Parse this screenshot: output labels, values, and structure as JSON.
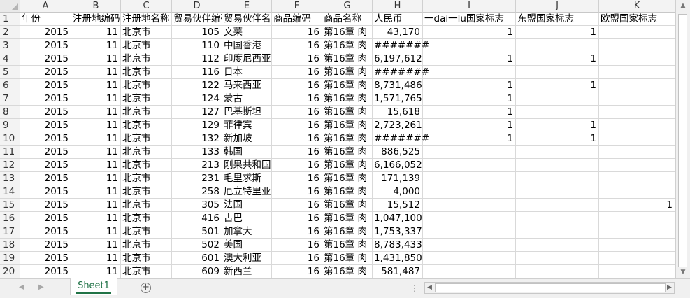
{
  "columns": [
    "A",
    "B",
    "C",
    "D",
    "E",
    "F",
    "G",
    "H",
    "I",
    "J",
    "K"
  ],
  "header_row": [
    "年份",
    "注册地编码",
    "注册地名称",
    "贸易伙伴编码",
    "贸易伙伴名称",
    "商品编码",
    "商品名称",
    "人民币",
    "一dai一lu国家标志",
    "东盟国家标志",
    "欧盟国家标志"
  ],
  "row_numbers": [
    "1",
    "2",
    "3",
    "4",
    "5",
    "6",
    "7",
    "8",
    "9",
    "10",
    "11",
    "12",
    "13",
    "14",
    "15",
    "16",
    "17",
    "18",
    "19",
    "20"
  ],
  "rows": [
    [
      "2015",
      "11",
      "北京市",
      "105",
      "文莱",
      "16",
      "第16章 肉",
      "43,170",
      "1",
      "1",
      ""
    ],
    [
      "2015",
      "11",
      "北京市",
      "110",
      "中国香港",
      "16",
      "第16章 肉",
      "#######",
      "",
      "",
      ""
    ],
    [
      "2015",
      "11",
      "北京市",
      "112",
      "印度尼西亚",
      "16",
      "第16章 肉",
      "6,197,612",
      "1",
      "1",
      ""
    ],
    [
      "2015",
      "11",
      "北京市",
      "116",
      "日本",
      "16",
      "第16章 肉",
      "#######",
      "",
      "",
      ""
    ],
    [
      "2015",
      "11",
      "北京市",
      "122",
      "马来西亚",
      "16",
      "第16章 肉",
      "8,731,486",
      "1",
      "1",
      ""
    ],
    [
      "2015",
      "11",
      "北京市",
      "124",
      "蒙古",
      "16",
      "第16章 肉",
      "1,571,765",
      "1",
      "",
      ""
    ],
    [
      "2015",
      "11",
      "北京市",
      "127",
      "巴基斯坦",
      "16",
      "第16章 肉",
      "15,618",
      "1",
      "",
      ""
    ],
    [
      "2015",
      "11",
      "北京市",
      "129",
      "菲律宾",
      "16",
      "第16章 肉",
      "2,723,261",
      "1",
      "1",
      ""
    ],
    [
      "2015",
      "11",
      "北京市",
      "132",
      "新加坡",
      "16",
      "第16章 肉",
      "#######",
      "1",
      "1",
      ""
    ],
    [
      "2015",
      "11",
      "北京市",
      "133",
      "韩国",
      "16",
      "第16章 肉",
      "886,525",
      "",
      "",
      ""
    ],
    [
      "2015",
      "11",
      "北京市",
      "213",
      "刚果共和国",
      "16",
      "第16章 肉",
      "6,166,052",
      "",
      "",
      ""
    ],
    [
      "2015",
      "11",
      "北京市",
      "231",
      "毛里求斯",
      "16",
      "第16章 肉",
      "171,139",
      "",
      "",
      ""
    ],
    [
      "2015",
      "11",
      "北京市",
      "258",
      "厄立特里亚",
      "16",
      "第16章 肉",
      "4,000",
      "",
      "",
      ""
    ],
    [
      "2015",
      "11",
      "北京市",
      "305",
      "法国",
      "16",
      "第16章 肉",
      "15,512",
      "",
      "",
      "1"
    ],
    [
      "2015",
      "11",
      "北京市",
      "416",
      "古巴",
      "16",
      "第16章 肉",
      "1,047,100",
      "",
      "",
      ""
    ],
    [
      "2015",
      "11",
      "北京市",
      "501",
      "加拿大",
      "16",
      "第16章 肉",
      "1,753,337",
      "",
      "",
      ""
    ],
    [
      "2015",
      "11",
      "北京市",
      "502",
      "美国",
      "16",
      "第16章 肉",
      "8,783,433",
      "",
      "",
      ""
    ],
    [
      "2015",
      "11",
      "北京市",
      "601",
      "澳大利亚",
      "16",
      "第16章 肉",
      "1,431,850",
      "",
      "",
      ""
    ],
    [
      "2015",
      "11",
      "北京市",
      "609",
      "新西兰",
      "16",
      "第16章 肉",
      "581,487",
      "",
      "",
      ""
    ]
  ],
  "sheet_tab": "Sheet1",
  "add_sheet_label": "+",
  "scroll_arrows": {
    "up": "▲",
    "down": "▼",
    "left": "◀",
    "right": "▶"
  },
  "nav_arrows": {
    "prev": "◀",
    "next": "▶"
  },
  "overflow_dots": "⋮",
  "colors": {
    "tab_accent": "#217346",
    "grid_line": "#d9d9d9",
    "header_bg": "#f3f3f3"
  }
}
